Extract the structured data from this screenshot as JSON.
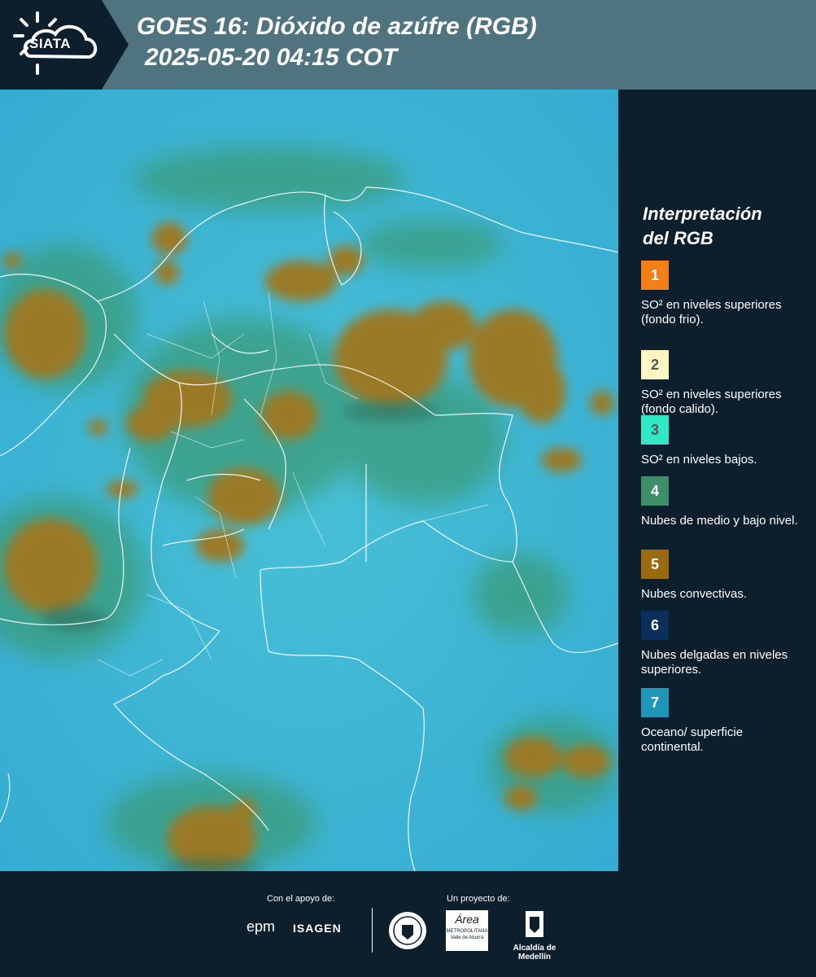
{
  "header": {
    "logo_text": "SIATA",
    "title_line1": "GOES 16: Dióxido de azúfre (RGB)",
    "title_line2": "2025-05-20 04:15 COT"
  },
  "legend": {
    "title_line1": "Interpretación",
    "title_line2": "del RGB",
    "items": [
      {
        "num": "1",
        "color": "#f57f17",
        "num_color": "#ffffff",
        "desc": "SO² en niveles superiores (fondo frio)."
      },
      {
        "num": "2",
        "color": "#fdf6c3",
        "num_color": "#555555",
        "desc": "SO² en niveles superiores (fondo calido)."
      },
      {
        "num": "3",
        "color": "#2ee8c6",
        "num_color": "#555555",
        "desc": "SO² en niveles bajos."
      },
      {
        "num": "4",
        "color": "#3d8f6a",
        "num_color": "#ffffff",
        "desc": "Nubes de medio y bajo nivel."
      },
      {
        "num": "5",
        "color": "#9a6a10",
        "num_color": "#ffffff",
        "desc": "Nubes convectivas."
      },
      {
        "num": "6",
        "color": "#0a2f5a",
        "num_color": "#ffffff",
        "desc": "Nubes delgadas en niveles superiores."
      },
      {
        "num": "7",
        "color": "#1d96b8",
        "num_color": "#ffffff",
        "desc": "Oceano/ superficie continental."
      }
    ]
  },
  "footer": {
    "support_label": "Con el apoyo de:",
    "project_label": "Un proyecto de:",
    "epm": "epm",
    "isagen": "ISAGEN",
    "area_name": "Área",
    "area_sub": "METROPOLITANA Valle de Aburrá",
    "alcaldia": "Alcaldía de Medellín"
  }
}
